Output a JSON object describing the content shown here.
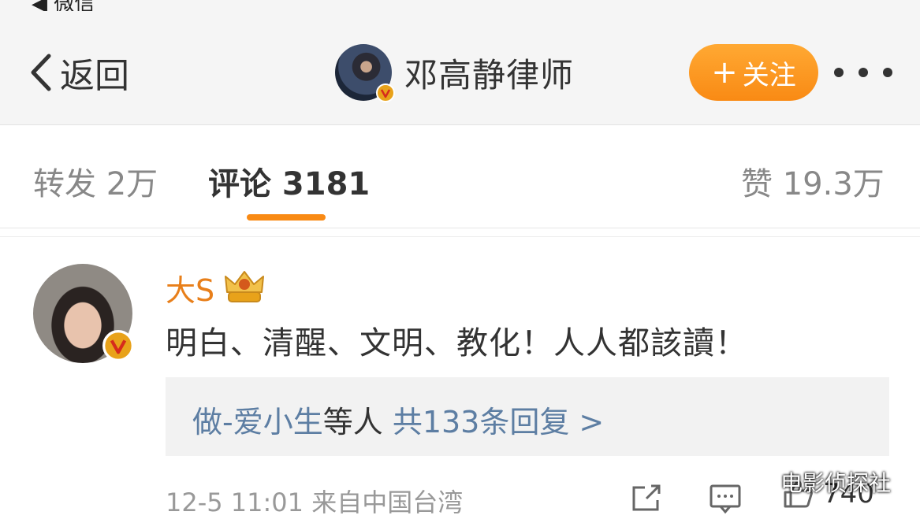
{
  "status_bar": {
    "back_app": "◀ 微信"
  },
  "nav": {
    "back_label": "返回",
    "author_name": "邓高静律师",
    "follow_plus": "+",
    "follow_label": "关注"
  },
  "tabs": {
    "reposts": "转发 2万",
    "comments": "评论 3181",
    "likes": "赞 19.3万"
  },
  "comment": {
    "username": "大S",
    "text": "明白、清醒、文明、教化！人人都該讀！",
    "reply_user": "做-爱小生",
    "reply_mid": "等人 ",
    "reply_total": "共133条回复 >",
    "meta": "12-5 11:01 来自中国台湾",
    "like_count": "740"
  },
  "watermark": "电影侦探社",
  "icons": [
    "chevron-left-icon",
    "verified-icon",
    "crown-badge-icon",
    "share-icon",
    "comment-icon",
    "like-icon"
  ],
  "colors": {
    "accent": "#f98a14",
    "username": "#e87f1a",
    "link": "#5d7ea3",
    "verified": "#e8a21a"
  }
}
